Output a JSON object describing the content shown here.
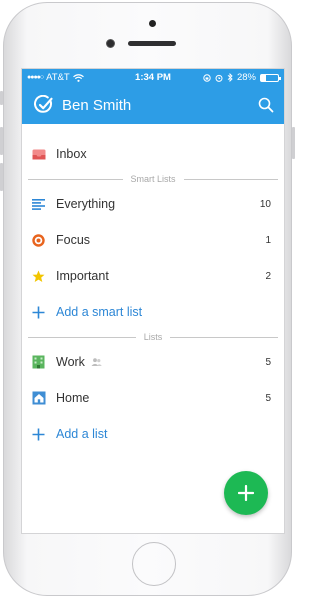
{
  "status": {
    "carrier": "AT&T",
    "time": "1:34 PM",
    "battery": "28%",
    "battery_level": 0.28
  },
  "header": {
    "user_name": "Ben Smith"
  },
  "inbox": {
    "label": "Inbox"
  },
  "smart_lists": {
    "heading": "Smart Lists",
    "items": [
      {
        "label": "Everything",
        "count": "10",
        "icon": "lines-icon",
        "color": "#2d87d6"
      },
      {
        "label": "Focus",
        "count": "1",
        "icon": "target-icon",
        "color": "#e8641e"
      },
      {
        "label": "Important",
        "count": "2",
        "icon": "star-icon",
        "color": "#f2c500"
      }
    ],
    "add_label": "Add a smart list"
  },
  "lists": {
    "heading": "Lists",
    "items": [
      {
        "label": "Work",
        "count": "5",
        "icon": "building-icon",
        "shared": true
      },
      {
        "label": "Home",
        "count": "5",
        "icon": "house-icon",
        "shared": false
      }
    ],
    "add_label": "Add a list"
  },
  "colors": {
    "accent": "#2d9de6",
    "fab": "#1db954",
    "link": "#2d87d6"
  }
}
